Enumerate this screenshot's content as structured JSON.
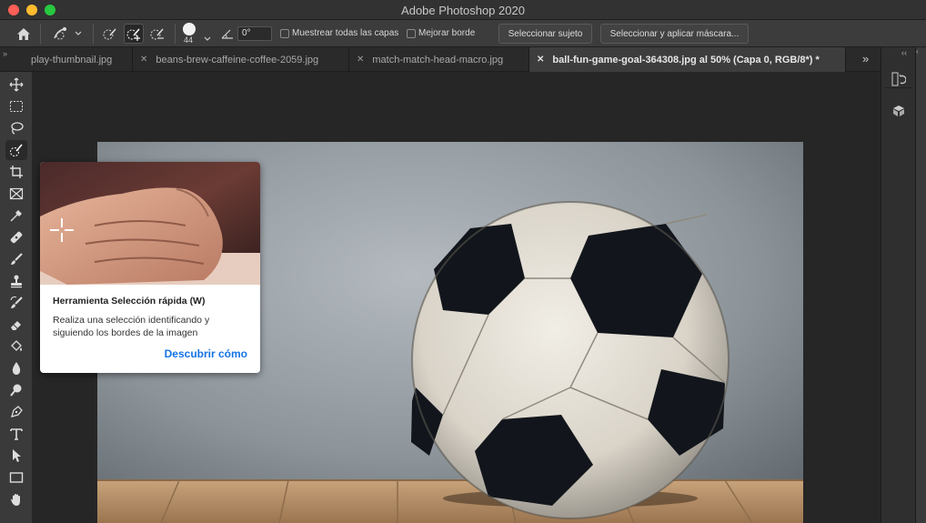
{
  "window": {
    "title": "Adobe Photoshop 2020",
    "traffic_lights": [
      "#fe5f57",
      "#febc2e",
      "#28c840"
    ]
  },
  "options_bar": {
    "brush_size": "44",
    "angle": "0°",
    "sample_all_layers_label": "Muestrear todas las capas",
    "enhance_edge_label": "Mejorar borde",
    "select_subject_label": "Seleccionar sujeto",
    "select_and_mask_label": "Seleccionar y aplicar máscara...",
    "sample_all_layers_checked": false,
    "enhance_edge_checked": false
  },
  "tabs": [
    {
      "label": "play-thumbnail.jpg",
      "active": false
    },
    {
      "label": "beans-brew-caffeine-coffee-2059.jpg",
      "active": false
    },
    {
      "label": "match-match-head-macro.jpg",
      "active": false
    },
    {
      "label": "ball-fun-game-goal-364308.jpg al 50% (Capa 0, RGB/8*) *",
      "active": true
    }
  ],
  "tooltip": {
    "title": "Herramienta Selección rápida (W)",
    "description": "Realiza una selección identificando y siguiendo los bordes de la imagen",
    "link": "Descubrir cómo"
  },
  "colors": {
    "accent_link": "#1473e6",
    "app_bg": "#282828"
  }
}
